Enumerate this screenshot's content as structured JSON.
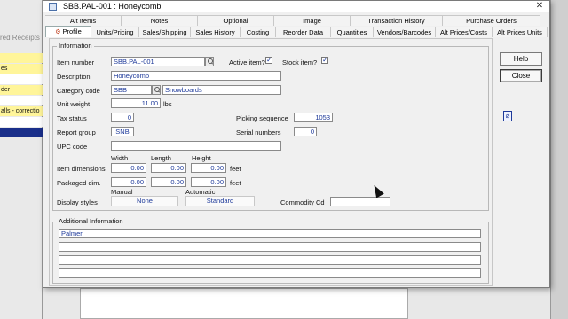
{
  "window": {
    "title": "SBB.PAL-001 : Honeycomb"
  },
  "background": {
    "receipts_label": "red Receipts",
    "rows": [
      {
        "text": "",
        "color": "#fff59a"
      },
      {
        "text": "es",
        "color": "#fff59a"
      },
      {
        "text": "",
        "color": "#ffffff"
      },
      {
        "text": "der",
        "color": "#fff59a"
      },
      {
        "text": "",
        "color": "#ffffff"
      },
      {
        "text": "alls - correctio",
        "color": "#fff59a"
      },
      {
        "text": "",
        "color": "#ffffff"
      },
      {
        "text": "",
        "color": "#1a2f8a"
      }
    ]
  },
  "tabs_top": [
    "Alt Items",
    "Notes",
    "Optional",
    "Image",
    "Transaction History",
    "Purchase Orders"
  ],
  "tabs_bottom": [
    "Profile",
    "Units/Pricing",
    "Sales/Shipping",
    "Sales History",
    "Costing",
    "Reorder Data",
    "Quantities",
    "Vendors/Barcodes",
    "Alt Prices/Costs",
    "Alt Prices Units"
  ],
  "information": {
    "group_label": "Information",
    "item_number_label": "Item number",
    "item_number": "SBB.PAL-001",
    "active_item_label": "Active item?",
    "active_item": "✓",
    "stock_item_label": "Stock item?",
    "stock_item": "✓",
    "description_label": "Description",
    "description": "Honeycomb",
    "category_code_label": "Category code",
    "category_code": "SBB",
    "category_name": "Snowboards",
    "unit_weight_label": "Unit weight",
    "unit_weight": "11.00",
    "unit_weight_unit": "lbs",
    "tax_status_label": "Tax status",
    "tax_status": "0",
    "picking_sequence_label": "Picking sequence",
    "picking_sequence": "1053",
    "report_group_label": "Report group",
    "report_group": "SNB",
    "serial_numbers_label": "Serial numbers",
    "serial_numbers": "0",
    "upc_code_label": "UPC code",
    "upc_code": "",
    "width_label": "Width",
    "length_label": "Length",
    "height_label": "Height",
    "item_dimensions_label": "Item dimensions",
    "item_width": "0.00",
    "item_length": "0.00",
    "item_height": "0.00",
    "item_dim_unit": "feet",
    "packaged_dim_label": "Packaged dim.",
    "pkg_width": "0.00",
    "pkg_length": "0.00",
    "pkg_height": "0.00",
    "pkg_dim_unit": "feet",
    "display_styles_label": "Display styles",
    "manual_label": "Manual",
    "manual_value": "None",
    "automatic_label": "Automatic",
    "automatic_value": "Standard",
    "commodity_cd_label": "Commodity Cd",
    "commodity_cd": ""
  },
  "additional": {
    "group_label": "Additional Information",
    "lines": [
      "Palmer",
      "",
      "",
      ""
    ]
  },
  "buttons": {
    "help": "Help",
    "close": "Close"
  },
  "icons": {
    "attachment": "paperclip-icon",
    "close": "close-icon"
  }
}
